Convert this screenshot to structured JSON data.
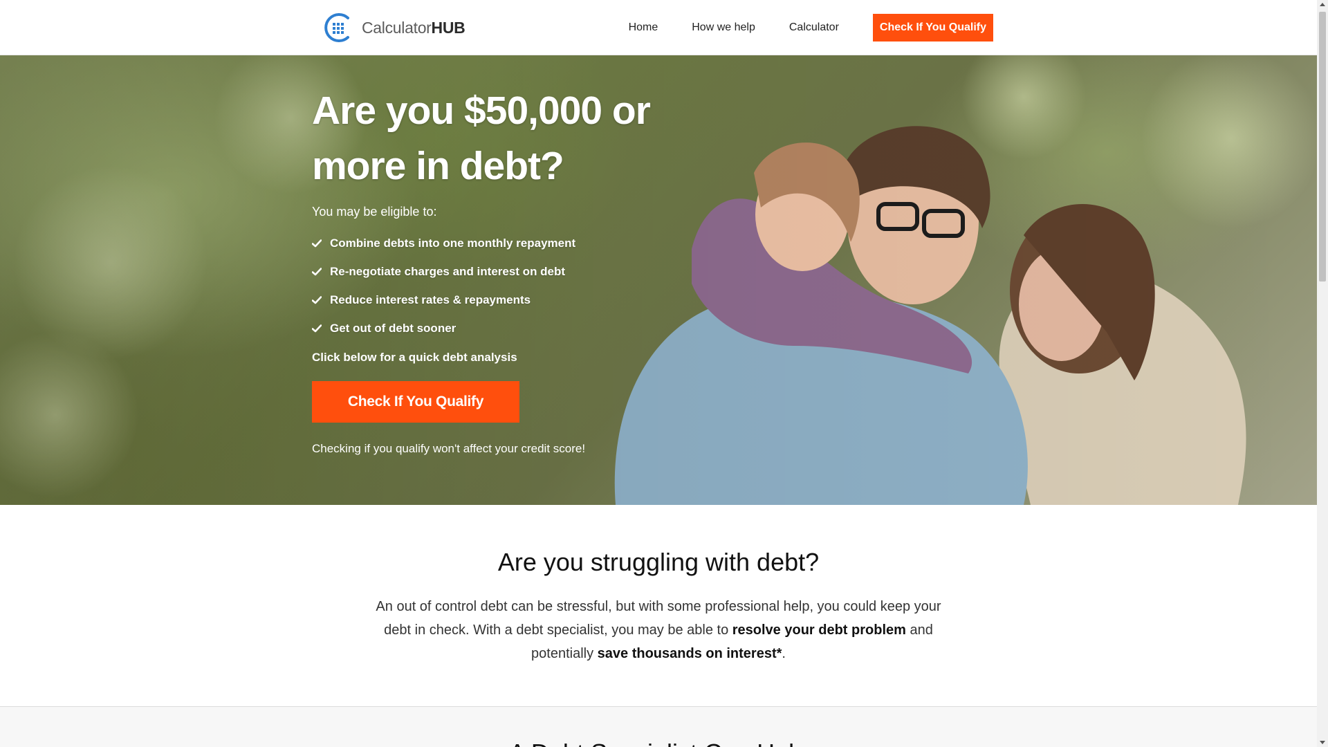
{
  "header": {
    "logo": {
      "name_regular": "Calculator",
      "name_bold": "HUB"
    },
    "nav": [
      {
        "label": "Home"
      },
      {
        "label": "How we help"
      },
      {
        "label": "Calculator"
      }
    ],
    "cta_label": "Check If You Qualify"
  },
  "hero": {
    "title": "Are you $50,000 or more in debt?",
    "subtitle": "You may be eligible to:",
    "benefits": [
      "Combine debts into one monthly repayment",
      "Re-negotiate charges and interest on debt",
      "Reduce interest rates & repayments",
      "Get out of debt sooner"
    ],
    "cta_intro": "Click below for a quick debt analysis",
    "cta_label": "Check If You Qualify",
    "note": "Checking if you qualify won't affect your credit score!"
  },
  "struggle": {
    "title": "Are you struggling with debt?",
    "text_1": "An out of control debt can be stressful, but with some professional help, you could keep your debt in check. With a debt specialist, you may be able to ",
    "bold_1": "resolve your debt problem",
    "text_2": " and potentially ",
    "bold_2": "save thousands on interest*",
    "text_3": "."
  },
  "next_section": {
    "title": "A Debt Specialist Can Help"
  },
  "colors": {
    "accent": "#ff4f0d",
    "logo_blue": "#2e7fd1"
  },
  "icons": [
    "calculator-logo-icon",
    "check-icon"
  ]
}
